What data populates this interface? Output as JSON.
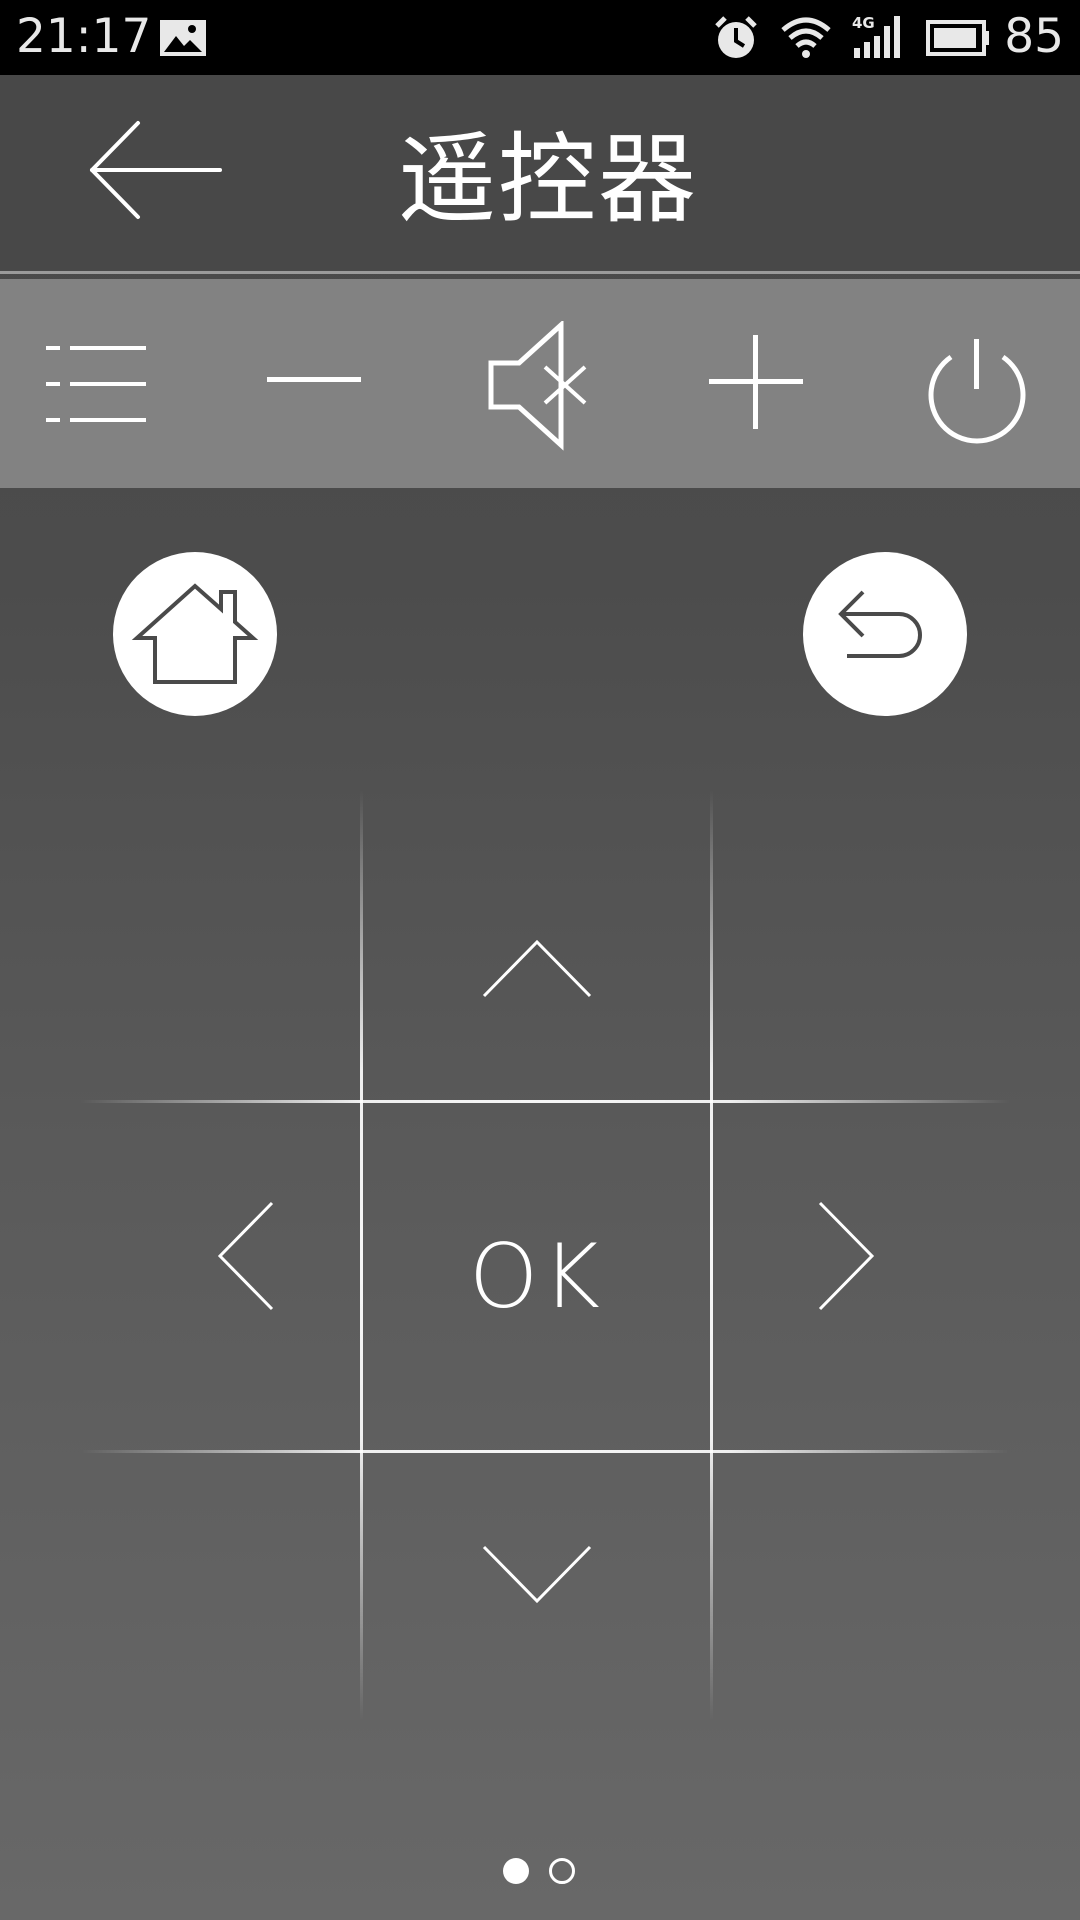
{
  "status_bar": {
    "time": "21:17",
    "battery_level": "85",
    "icons": [
      "image-icon",
      "alarm-icon",
      "wifi-icon",
      "signal-4g-icon",
      "battery-icon"
    ]
  },
  "header": {
    "title": "遥控器",
    "back_icon": "arrow-left-icon"
  },
  "toolbar": {
    "items": [
      {
        "name": "menu",
        "icon": "menu-list-icon"
      },
      {
        "name": "volume-down",
        "icon": "minus-icon"
      },
      {
        "name": "mute",
        "icon": "mute-icon"
      },
      {
        "name": "volume-up",
        "icon": "plus-icon"
      },
      {
        "name": "power",
        "icon": "power-icon"
      }
    ]
  },
  "round_buttons": {
    "home_icon": "home-icon",
    "return_icon": "return-icon"
  },
  "dpad": {
    "ok_label": "OK",
    "up_icon": "chevron-up-icon",
    "down_icon": "chevron-down-icon",
    "left_icon": "chevron-left-icon",
    "right_icon": "chevron-right-icon"
  },
  "pager": {
    "current_page": 1,
    "total_pages": 2
  },
  "colors": {
    "status_bar_bg": "#000000",
    "header_bg": "#484848",
    "toolbar_bg": "#828282",
    "icon_color": "#ffffff",
    "button_bg": "#ffffff"
  }
}
